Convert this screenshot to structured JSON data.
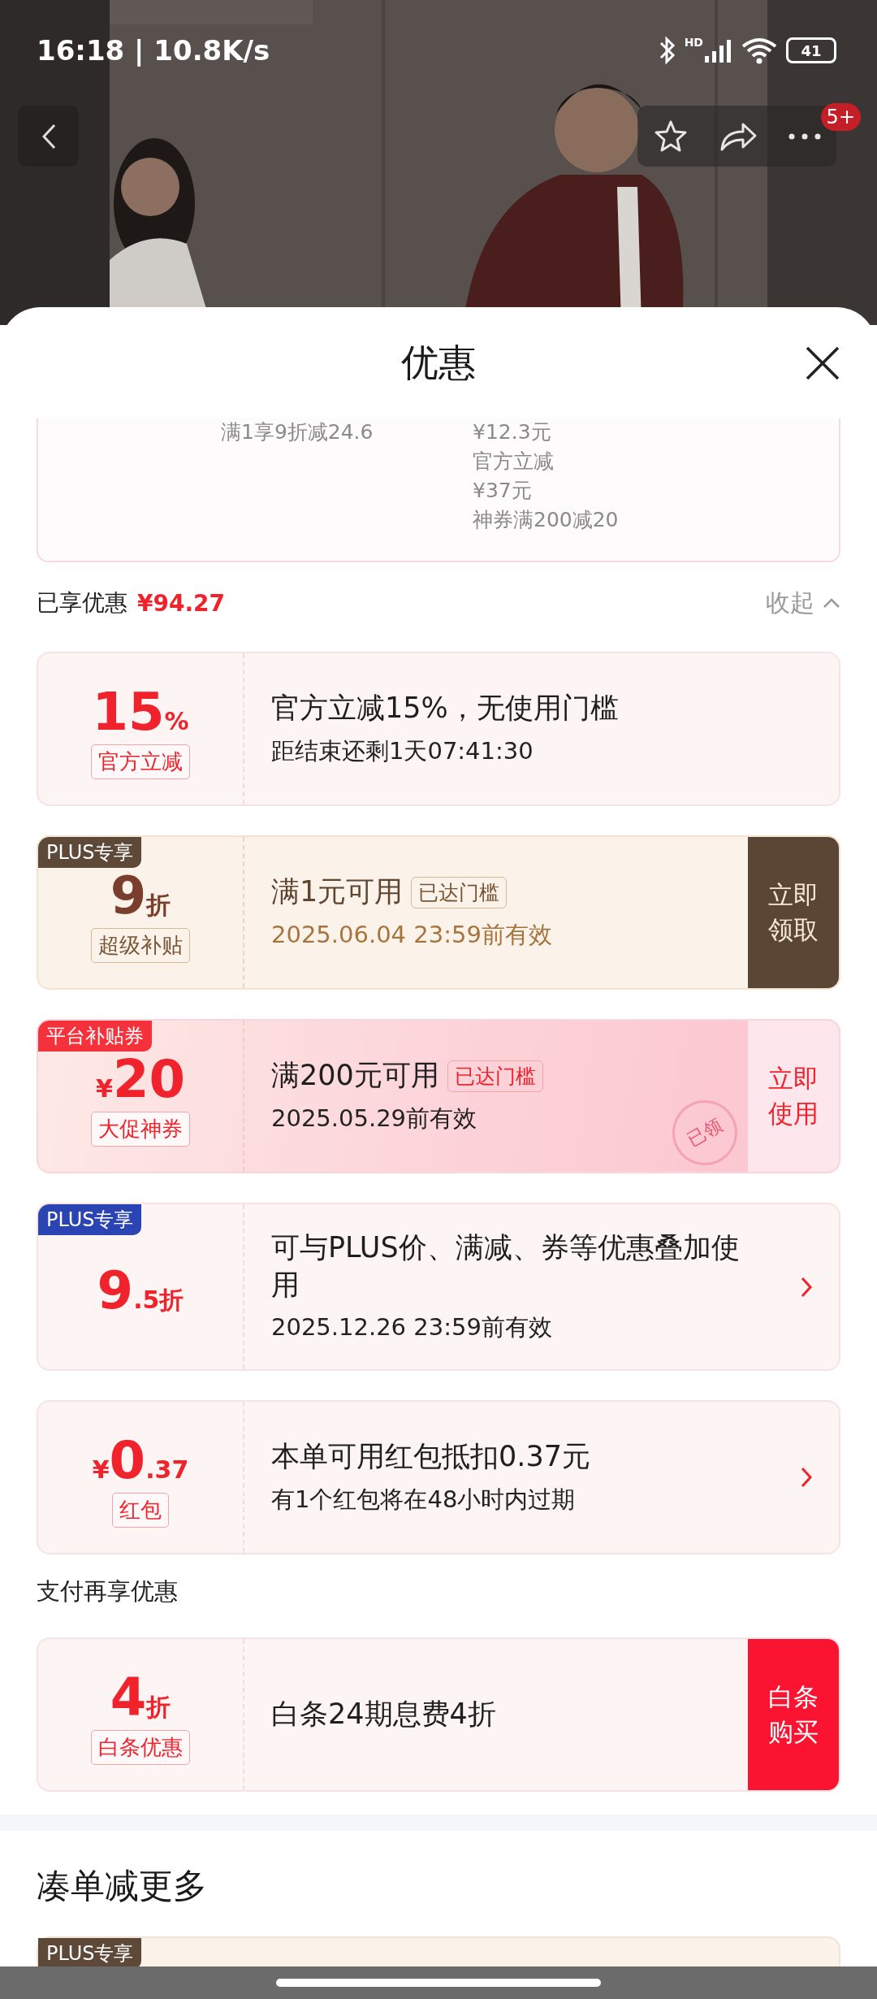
{
  "status_bar": {
    "time": "16:18 | 10.8K/s",
    "network_label": "HD",
    "battery": "41"
  },
  "top_nav": {
    "badge": "5+"
  },
  "sheet": {
    "title": "优惠"
  },
  "summary_card": {
    "left": [
      "满1享9折减24.6"
    ],
    "right": [
      "¥12.3元",
      "官方立减",
      "¥37元",
      "神券满200减20"
    ]
  },
  "savings": {
    "label": "已享优惠",
    "amount": "¥94.27",
    "collapse": "收起"
  },
  "coupons": [
    {
      "kind": "red",
      "value": {
        "main": "15",
        "suffix": "%"
      },
      "tag": "官方立减",
      "title": "官方立减15%，无使用门槛",
      "subtitle": "距结束还剩1天07:41:30",
      "action": {
        "kind": "none"
      }
    },
    {
      "kind": "gold",
      "badge": {
        "text": "PLUS专享",
        "color": "#5e4838"
      },
      "value": {
        "main": "9",
        "suffix": "折"
      },
      "tag": "超级补贴",
      "title": "满1元可用",
      "threshold": "已达门槛",
      "subtitle": "2025.06.04 23:59前有效",
      "action": {
        "kind": "button",
        "label": "立即领取"
      }
    },
    {
      "kind": "pink",
      "badge": {
        "text": "平台补贴券",
        "color": "#f5323c"
      },
      "value": {
        "prefix": "¥",
        "main": "20"
      },
      "tag": "大促神券",
      "title": "满200元可用",
      "threshold": "已达门槛",
      "subtitle": "2025.05.29前有效",
      "stamp": "已领",
      "action": {
        "kind": "button",
        "label": "立即使用"
      }
    },
    {
      "kind": "red",
      "badge": {
        "text": "PLUS专享",
        "color": "#2b44b3"
      },
      "value": {
        "main": "9",
        "suffix": ".5折"
      },
      "title": "可与PLUS价、满减、券等优惠叠加使用",
      "subtitle": "2025.12.26 23:59前有效",
      "action": {
        "kind": "chevron"
      }
    },
    {
      "kind": "red",
      "value": {
        "prefix": "¥",
        "main": "0",
        "suffix": ".37"
      },
      "tag": "红包",
      "title": "本单可用红包抵扣0.37元",
      "subtitle": "有1个红包将在48小时内过期",
      "action": {
        "kind": "chevron"
      }
    }
  ],
  "payment_section": {
    "title": "支付再享优惠",
    "coupons": [
      {
        "kind": "red",
        "value": {
          "main": "4",
          "suffix": "折"
        },
        "tag": "白条优惠",
        "title": "白条24期息费4折",
        "action": {
          "kind": "solid",
          "label": "白条购买"
        }
      }
    ]
  },
  "more_section": {
    "title": "凑单减更多",
    "peek_badge": "PLUS专享"
  }
}
